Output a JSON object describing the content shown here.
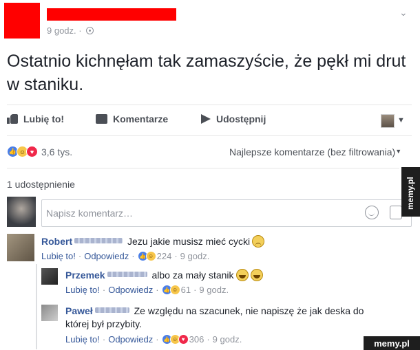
{
  "post": {
    "time": "9 godz. ·",
    "text": "Ostatnio kichnęłam tak zamaszyście, że pękł mi drut w staniku."
  },
  "actions": {
    "like": "Lubię to!",
    "comment": "Komentarze",
    "share": "Udostępnij"
  },
  "reactions": {
    "count": "3,6 tys.",
    "filter": "Najlepsze komentarze (bez filtrowania)"
  },
  "shares": "1 udostępnienie",
  "composer": {
    "placeholder": "Napisz komentarz…"
  },
  "comments": [
    {
      "name": "Robert",
      "text": "Jezu jakie musisz mieć cycki",
      "like": "Lubię to!",
      "reply": "Odpowiedz",
      "count": "224",
      "time": "9 godz."
    },
    {
      "name": "Przemek",
      "text": "albo za mały stanik",
      "like": "Lubię to!",
      "reply": "Odpowiedz",
      "count": "61",
      "time": "9 godz."
    },
    {
      "name": "Paweł",
      "text": "Ze względu na szacunek, nie napiszę że jak deska do której był przybity.",
      "like": "Lubię to!",
      "reply": "Odpowiedz",
      "count": "306",
      "time": "9 godz."
    }
  ],
  "watermarks": {
    "side": "memy.pl",
    "bottom": "memy.pl"
  },
  "colors": {
    "link": "#365899",
    "redaction": "#ff0000",
    "like_blue": "#4a7ee8",
    "love_red": "#f0284a",
    "haha_yellow": "#f7c64a"
  }
}
